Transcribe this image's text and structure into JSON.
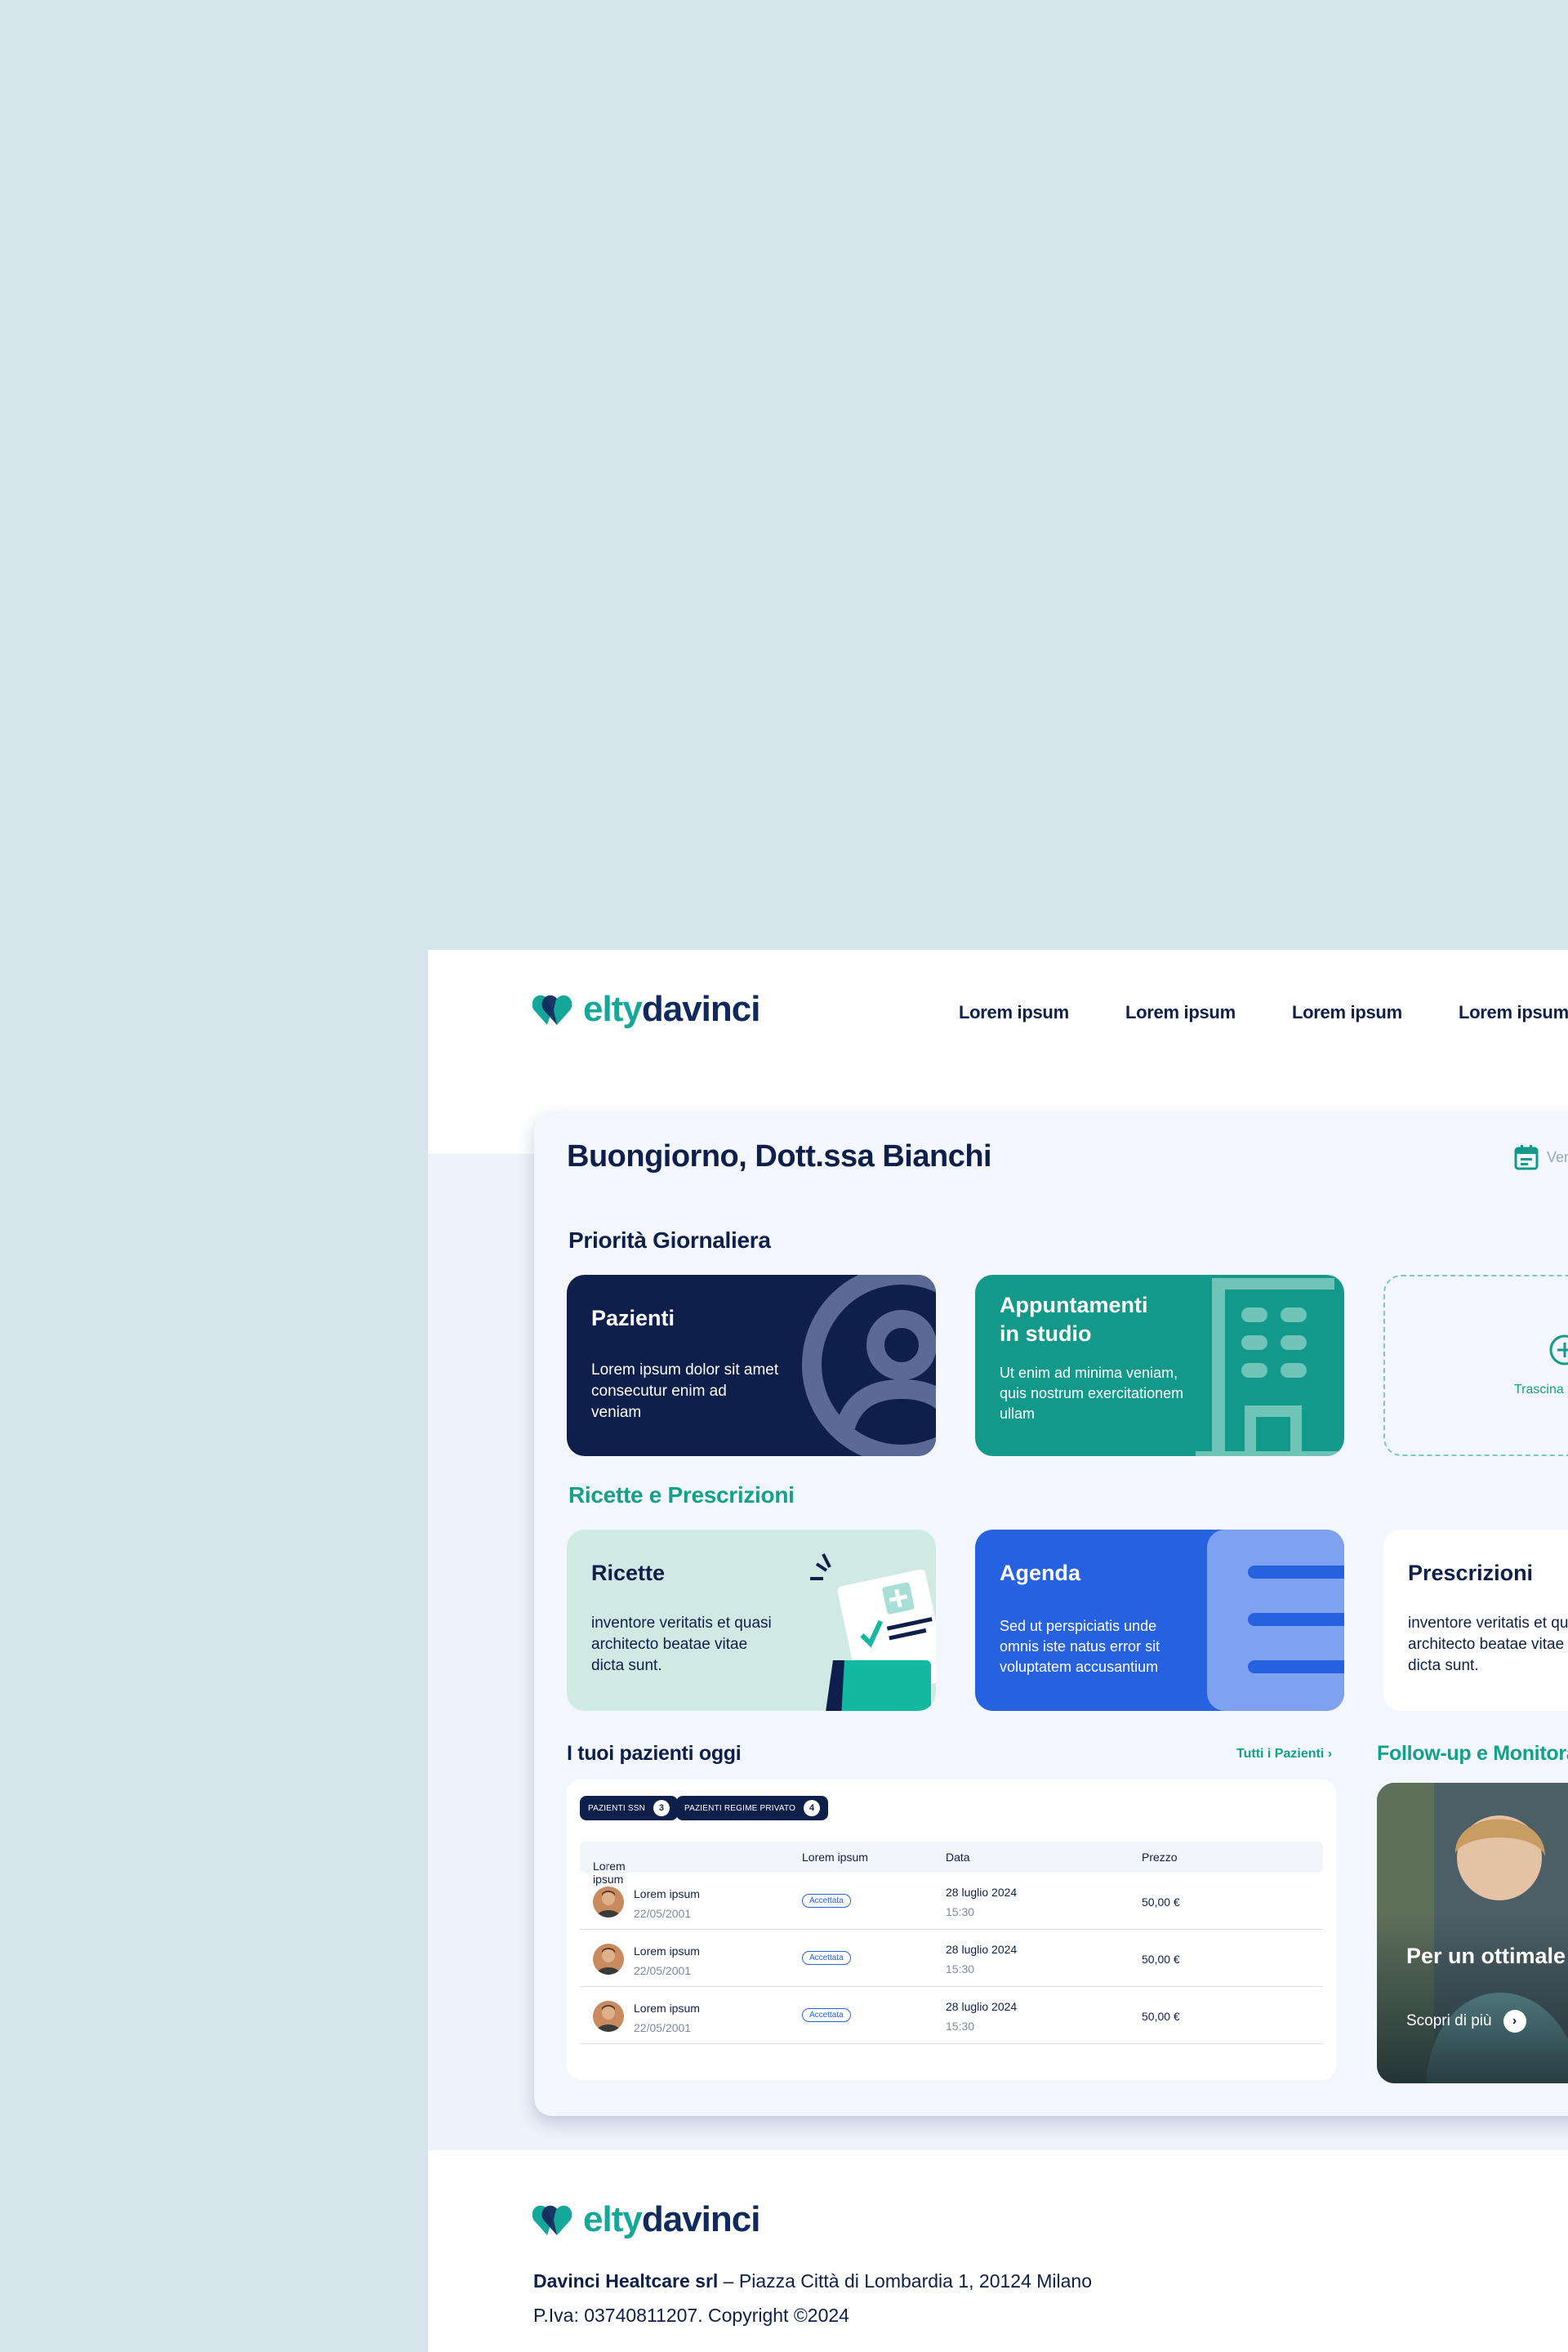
{
  "brand": {
    "logo_part1": "elty",
    "logo_part2": "davinci"
  },
  "nav": {
    "items": [
      "Lorem ipsum",
      "Lorem ipsum",
      "Lorem ipsum",
      "Lorem ipsum"
    ]
  },
  "dashboard": {
    "greeting": "Buongiorno, Dott.ssa Bianchi",
    "date_text": "Venerdì",
    "section_priority": "Priorità Giornaliera",
    "section_recipes": "Ricette e Prescrizioni",
    "section_patients": "I tuoi pazienti oggi",
    "section_followup": "Follow-up e Monitoraggio",
    "all_patients_link": "Tutti i Pazienti"
  },
  "tiles": {
    "pazienti": {
      "title": "Pazienti",
      "desc": "Lorem ipsum dolor sit amet consecutur enim ad veniam"
    },
    "appuntamenti": {
      "title": "Appuntamenti in studio",
      "desc": "Ut enim ad minima veniam, quis nostrum exercitationem ullam"
    },
    "drop": {
      "text": "Trascina qui"
    },
    "ricette": {
      "title": "Ricette",
      "desc": "inventore veritatis et quasi architecto beatae vitae dicta sunt."
    },
    "agenda": {
      "title": "Agenda",
      "desc": "Sed ut perspiciatis unde omnis iste natus error sit voluptatem accusantium"
    },
    "prescrizioni": {
      "title": "Prescrizioni",
      "desc": "inventore veritatis et quasi architecto beatae vitae dicta sunt."
    }
  },
  "patients": {
    "chips": [
      {
        "label": "PAZIENTI SSN",
        "count": "3"
      },
      {
        "label": "PAZIENTI REGIME PRIVATO",
        "count": "4"
      }
    ],
    "headers": [
      "Lorem ipsum",
      "Lorem ipsum",
      "Data",
      "Prezzo"
    ],
    "sort_icon": "↓",
    "rows": [
      {
        "name": "Lorem ipsum",
        "dob": "22/05/2001",
        "status": "Accettata",
        "date": "28 luglio 2024",
        "time": "15:30",
        "price": "50,00 €"
      },
      {
        "name": "Lorem ipsum",
        "dob": "22/05/2001",
        "status": "Accettata",
        "date": "28 luglio 2024",
        "time": "15:30",
        "price": "50,00 €"
      },
      {
        "name": "Lorem ipsum",
        "dob": "22/05/2001",
        "status": "Accettata",
        "date": "28 luglio 2024",
        "time": "15:30",
        "price": "50,00 €"
      }
    ]
  },
  "followup": {
    "title": "Per un ottimale monitoraggio dei",
    "cta": "Scopri di più"
  },
  "footer": {
    "company": "Davinci Healtcare srl",
    "address": " – Piazza Città di Lombardia 1, 20124 Milano",
    "vat": "P.Iva: 03740811207. Copyright ©2024"
  },
  "colors": {
    "navy": "#0f1f4b",
    "teal": "#13998a",
    "mint": "#cfeae3",
    "blue": "#2662e0",
    "bg": "#d6e5ec"
  }
}
